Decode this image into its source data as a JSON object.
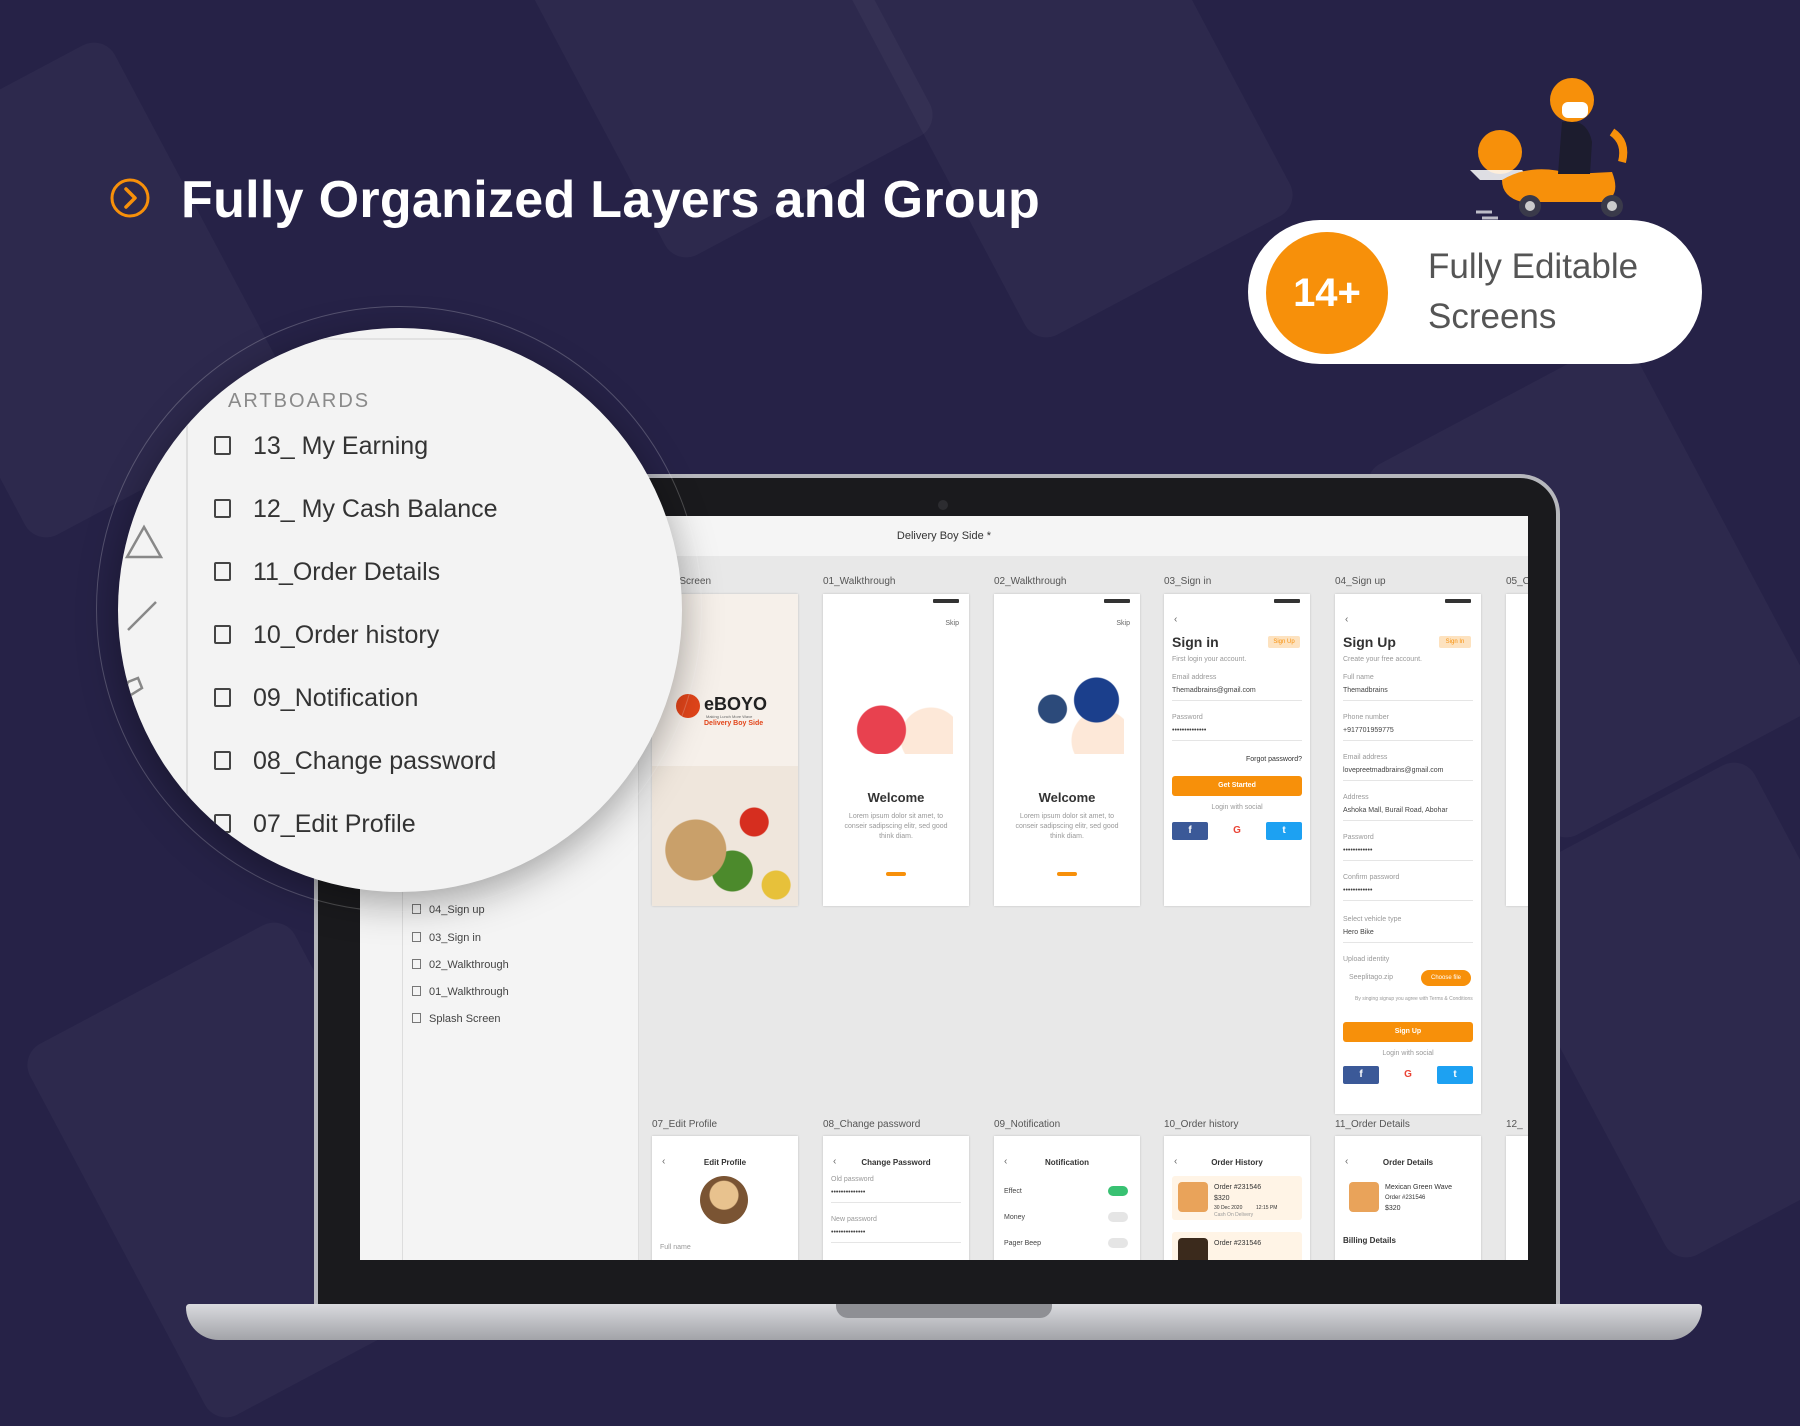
{
  "header": {
    "title": "Fully Organized Layers and Group",
    "icon": "chevron-right-circle-icon"
  },
  "badge": {
    "count": "14+",
    "text": "Fully Editable Screens"
  },
  "colors": {
    "accent": "#f7900a",
    "background": "#262247"
  },
  "magnifier": {
    "heading": "ARTBOARDS",
    "items": [
      "13_ My Earning",
      "12_ My Cash Balance",
      "11_Order Details",
      "10_Order history",
      "09_Notification",
      "08_Change password",
      "07_Edit Profile"
    ]
  },
  "app": {
    "title": "Delivery Boy Side *",
    "layers": [
      "04_Sign up",
      "03_Sign in",
      "02_Walkthrough",
      "01_Walkthrough",
      "Splash Screen"
    ]
  },
  "artboards": {
    "labels": [
      "sh Screen",
      "01_Walkthrough",
      "02_Walkthrough",
      "03_Sign in",
      "04_Sign up",
      "05_C",
      "07_Edit Profile",
      "08_Change password",
      "09_Notification",
      "10_Order history",
      "11_Order Details",
      "12_"
    ],
    "splash": {
      "brand": "eBOYO",
      "tagline": "Making Lunch More Wave",
      "sub": "Delivery Boy Side"
    },
    "walk": {
      "skip": "Skip",
      "title": "Welcome",
      "text": "Lorem ipsum dolor sit amet, to conseir sadipscing elitr, sed good think diam."
    },
    "signin": {
      "title": "Sign in",
      "tag": "Sign Up",
      "subtitle": "First login your account.",
      "email_label": "Email address",
      "email": "Themadbrains@gmail.com",
      "password_label": "Password",
      "password": "••••••••••••••",
      "forgot": "Forgot password?",
      "button": "Get Started",
      "social": "Login with social"
    },
    "signup": {
      "title": "Sign Up",
      "tag": "Sign In",
      "subtitle": "Create your free account.",
      "fields": [
        {
          "label": "Full name",
          "value": "Themadbrains"
        },
        {
          "label": "Phone number",
          "value": "+917701959775"
        },
        {
          "label": "Email address",
          "value": "lovepreetmadbrains@gmail.com"
        },
        {
          "label": "Address",
          "value": "Ashoka Mall, Burail Road, Abohar"
        },
        {
          "label": "Password",
          "value": "••••••••••••"
        },
        {
          "label": "Confirm password",
          "value": "••••••••••••"
        }
      ],
      "vehicle_label": "Select vehicle type",
      "vehicle": "Hero Bike",
      "identity_label": "Upload identity",
      "identity": "Seeplitago.zip",
      "choose": "Choose file",
      "terms": "By singing signup you agree with Terms & Conditions",
      "button": "Sign Up",
      "social": "Login with social"
    },
    "editprofile": {
      "title": "Edit Profile",
      "field": "Full name"
    },
    "changepw": {
      "title": "Change Password",
      "old": "Old password",
      "new": "New password",
      "value": "••••••••••••••"
    },
    "notification": {
      "title": "Notification",
      "rows": [
        "Effect",
        "Money",
        "Pager Beep"
      ]
    },
    "orderhistory": {
      "title": "Order History",
      "order": "Order #231546",
      "price": "$320",
      "date": "30 Dec 2020",
      "time": "12:15 PM",
      "pay": "Cash On Delivery"
    },
    "orderdetails": {
      "title": "Order Details",
      "item": "Mexican Green Wave",
      "order": "Order #231546",
      "price": "$320",
      "billing": "Billing Details"
    }
  }
}
